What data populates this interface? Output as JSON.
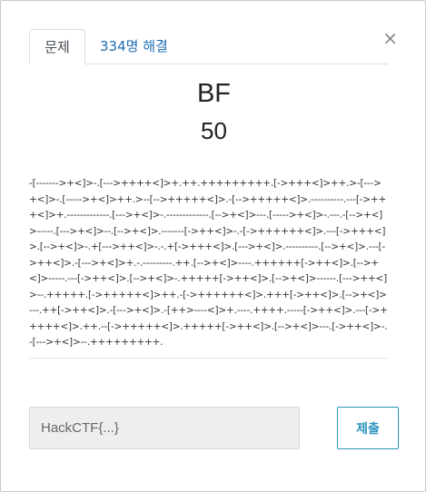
{
  "tabs": {
    "problem_label": "문제",
    "solves_label": "334명 해결"
  },
  "close_symbol": "×",
  "challenge": {
    "title": "BF",
    "points": "50",
    "description": "-[------->+<]>-.[--->++++<]>+.++.+++++++++.[->+++<]>++.>-[--->+<]>-.[----->+<]>++.>--[-->+++++<]>.-[-->+++++<]>.----------.---[->+++<]>+.-------------.[--->+<]>-.-------------.[-->+<]>---.[----->+<]>-.---.-[-->+<]>-----.[--->+<]>--.[-->+<]>.-------[->++<]>-.-[->++++++<]>.---[->+++<]>.[-->+<]>-.+[--->++<]>-.-.+[->+++<]>.[--->+<]>.----------.[-->+<]>.---[->++<]>.-[--->+<]>+.-.---------.++.[-->+<]>----.++++++[->++<]>.[-->+<]>-----.---[->++<]>.[-->+<]>-.+++++[->++<]>.[-->+<]>------.[--->++<]>--.+++++.[->+++++<]>++.-[->++++++<]>.+++[->++<]>.[-->+<]>---.++[->++<]>.-[--->+<]>.-[++>----<]>+.----.++++.-----[->++<]>.---[->+++++<]>.++.--[->+++++<]>.+++++[->++<]>.[-->+<]>---.[->++<]>-.-[--->+<]>--.+++++++++."
  },
  "flag_input": {
    "value": "",
    "placeholder": "HackCTF{...}"
  },
  "submit_label": "제출"
}
